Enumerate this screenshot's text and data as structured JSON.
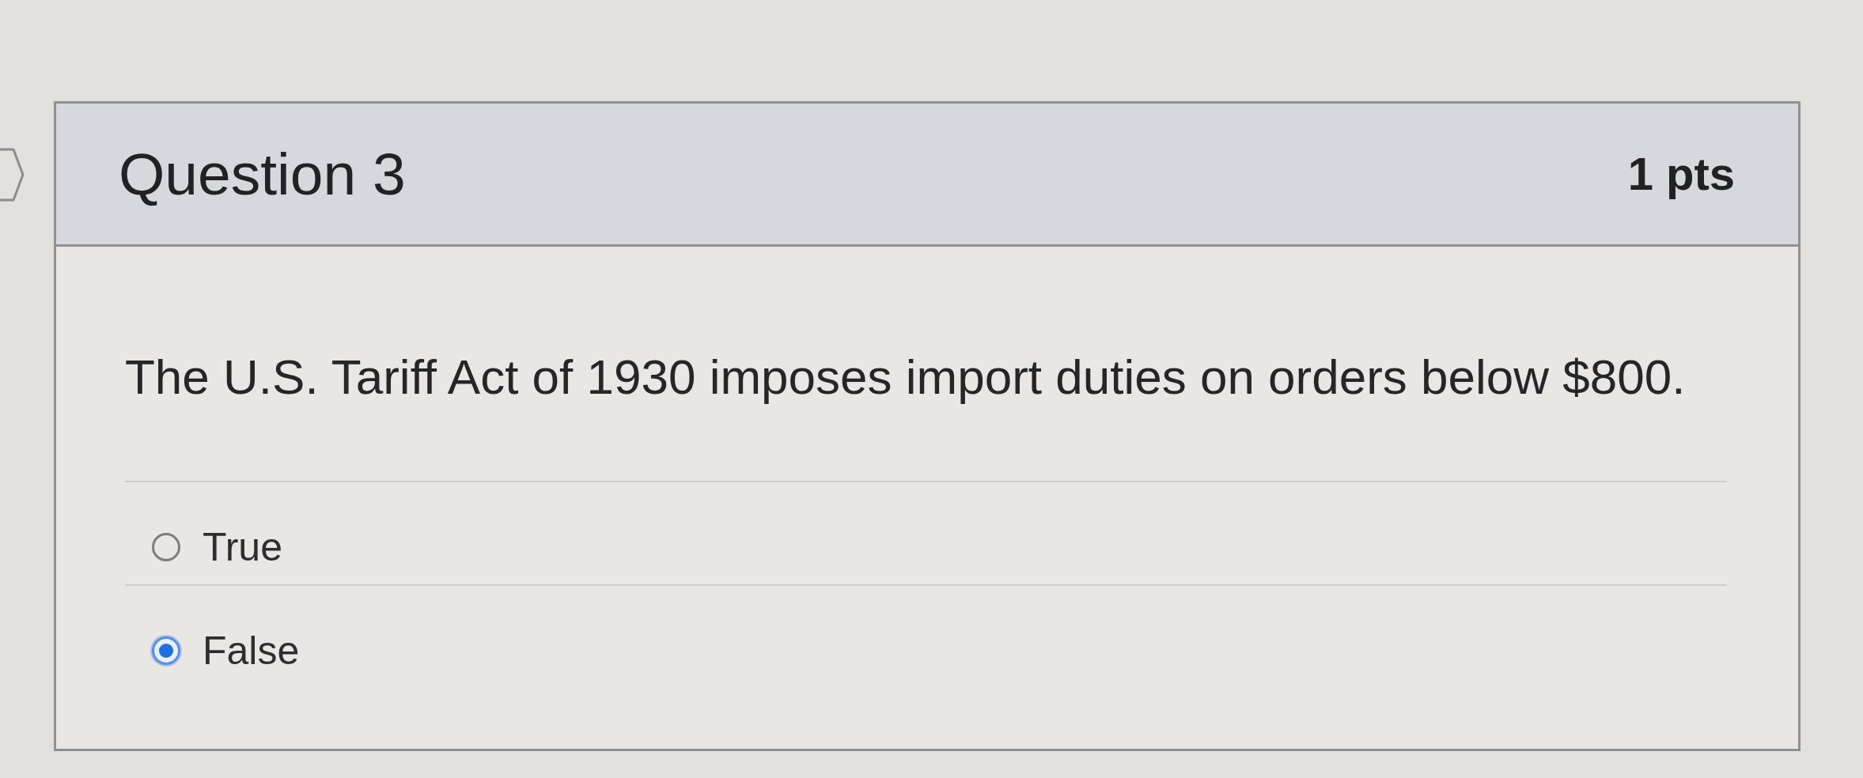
{
  "question": {
    "title": "Question 3",
    "points": "1 pts",
    "text": "The U.S. Tariff Act of 1930 imposes import duties on orders below $800.",
    "answers": [
      {
        "label": "True",
        "selected": false
      },
      {
        "label": "False",
        "selected": true
      }
    ]
  }
}
